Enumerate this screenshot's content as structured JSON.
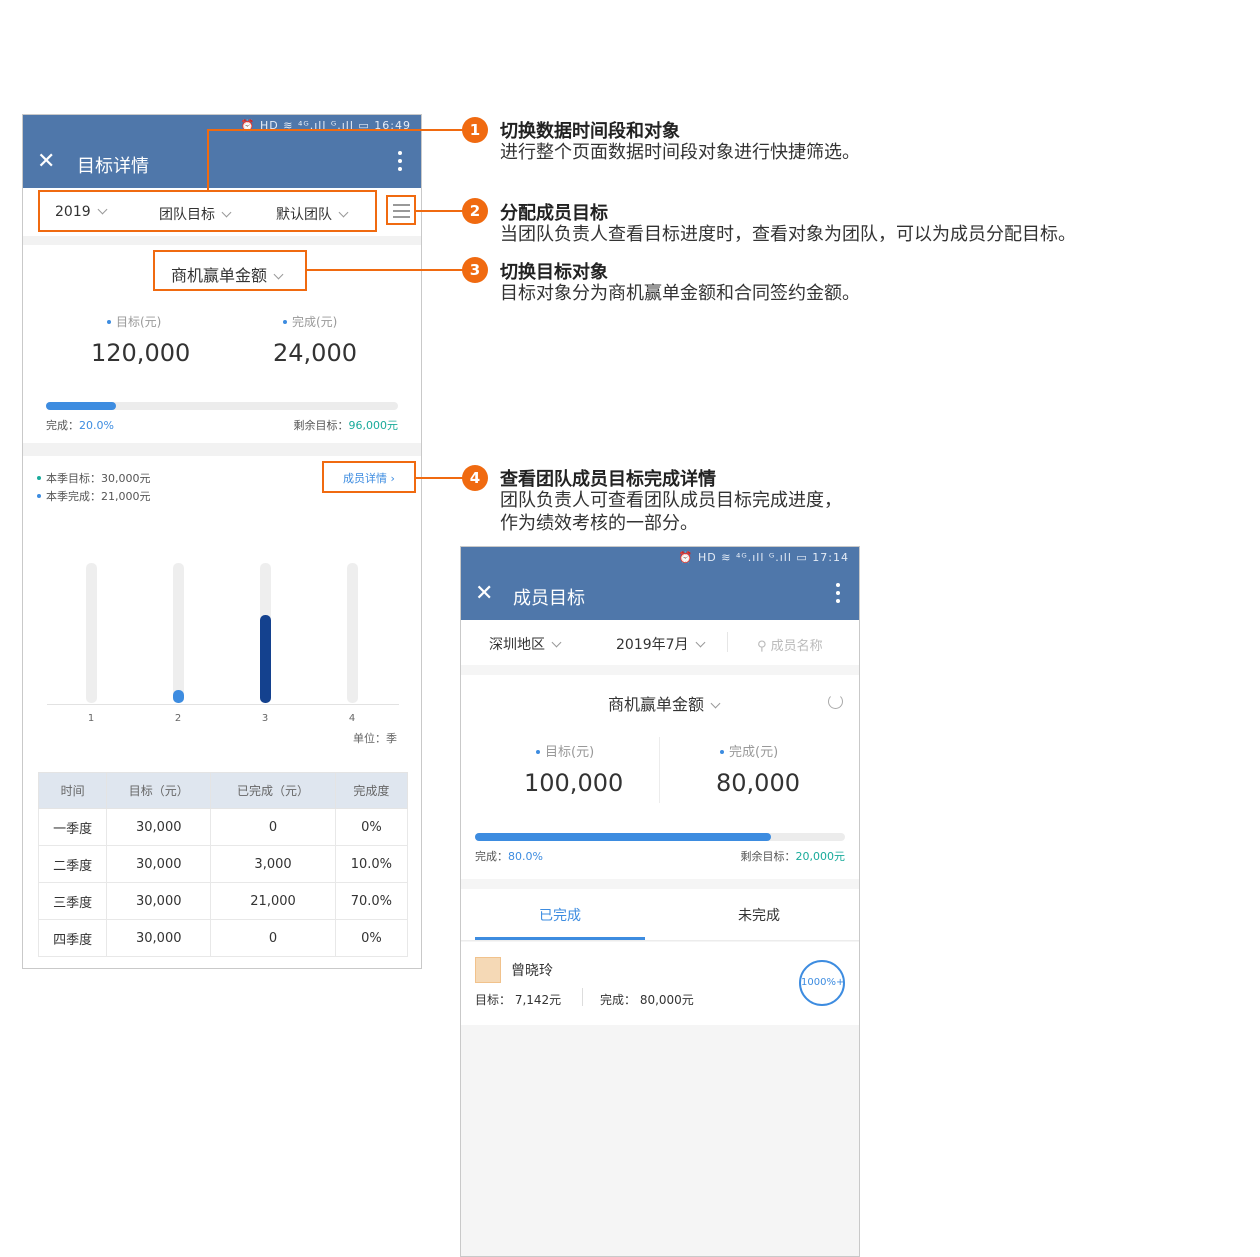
{
  "phone1": {
    "status": "⏰ HD ≋ ⁴ᴳ.ıll ᴳ.ıll ▭ 16:49",
    "title": "目标详情",
    "filters": {
      "year": "2019",
      "type": "团队目标",
      "team": "默认团队"
    },
    "target_object": "商机赢单金额",
    "target_label": "目标(元)",
    "done_label": "完成(元)",
    "target_value": "120,000",
    "done_value": "24,000",
    "progress_pct": 0.2,
    "done_caption": "完成：",
    "done_pct_text": "20.0%",
    "remain_caption": "剩余目标：",
    "remain_value": "96,000元",
    "quarter_target": "本季目标：30,000元",
    "quarter_done": "本季完成：21,000元",
    "member_detail": "成员详情",
    "unit": "单位：季",
    "chart_data": {
      "type": "bar",
      "categories": [
        "1",
        "2",
        "3",
        "4"
      ],
      "values": [
        0,
        3000,
        21000,
        0
      ],
      "ylim": [
        0,
        30000
      ],
      "xlabel": "",
      "ylabel": "",
      "colors": [
        "#3d8ce0",
        "#3d8ce0",
        "#14418e",
        "#3d8ce0"
      ]
    },
    "table": {
      "headers": [
        "时间",
        "目标（元）",
        "已完成（元）",
        "完成度"
      ],
      "rows": [
        [
          "一季度",
          "30,000",
          "0",
          "0%"
        ],
        [
          "二季度",
          "30,000",
          "3,000",
          "10.0%"
        ],
        [
          "三季度",
          "30,000",
          "21,000",
          "70.0%"
        ],
        [
          "四季度",
          "30,000",
          "0",
          "0%"
        ]
      ]
    }
  },
  "annotations": [
    {
      "num": "1",
      "title": "切换数据时间段和对象",
      "desc": "进行整个页面数据时间段对象进行快捷筛选。"
    },
    {
      "num": "2",
      "title": "分配成员目标",
      "desc": "当团队负责人查看目标进度时，查看对象为团队，可以为成员分配目标。"
    },
    {
      "num": "3",
      "title": "切换目标对象",
      "desc": "目标对象分为商机赢单金额和合同签约金额。"
    },
    {
      "num": "4",
      "title": "查看团队成员目标完成详情",
      "desc": "团队负责人可查看团队成员目标完成进度，作为绩效考核的一部分。"
    }
  ],
  "phone2": {
    "status": "⏰ HD ≋ ⁴ᴳ.ıll ᴳ.ıll ▭ 17:14",
    "title": "成员目标",
    "filters": {
      "region": "深圳地区",
      "month": "2019年7月",
      "search_placeholder": "成员名称"
    },
    "target_object": "商机赢单金额",
    "target_label": "目标(元)",
    "done_label": "完成(元)",
    "target_value": "100,000",
    "done_value": "80,000",
    "progress_pct": 0.8,
    "done_caption": "完成：",
    "done_pct_text": "80.0%",
    "remain_caption": "剩余目标：",
    "remain_value": "20,000元",
    "tab_done": "已完成",
    "tab_undone": "未完成",
    "member": {
      "name": "曾晓玲",
      "target": "目标：  7,142元",
      "done": "完成：  80,000元",
      "ring": "1000%+"
    }
  }
}
